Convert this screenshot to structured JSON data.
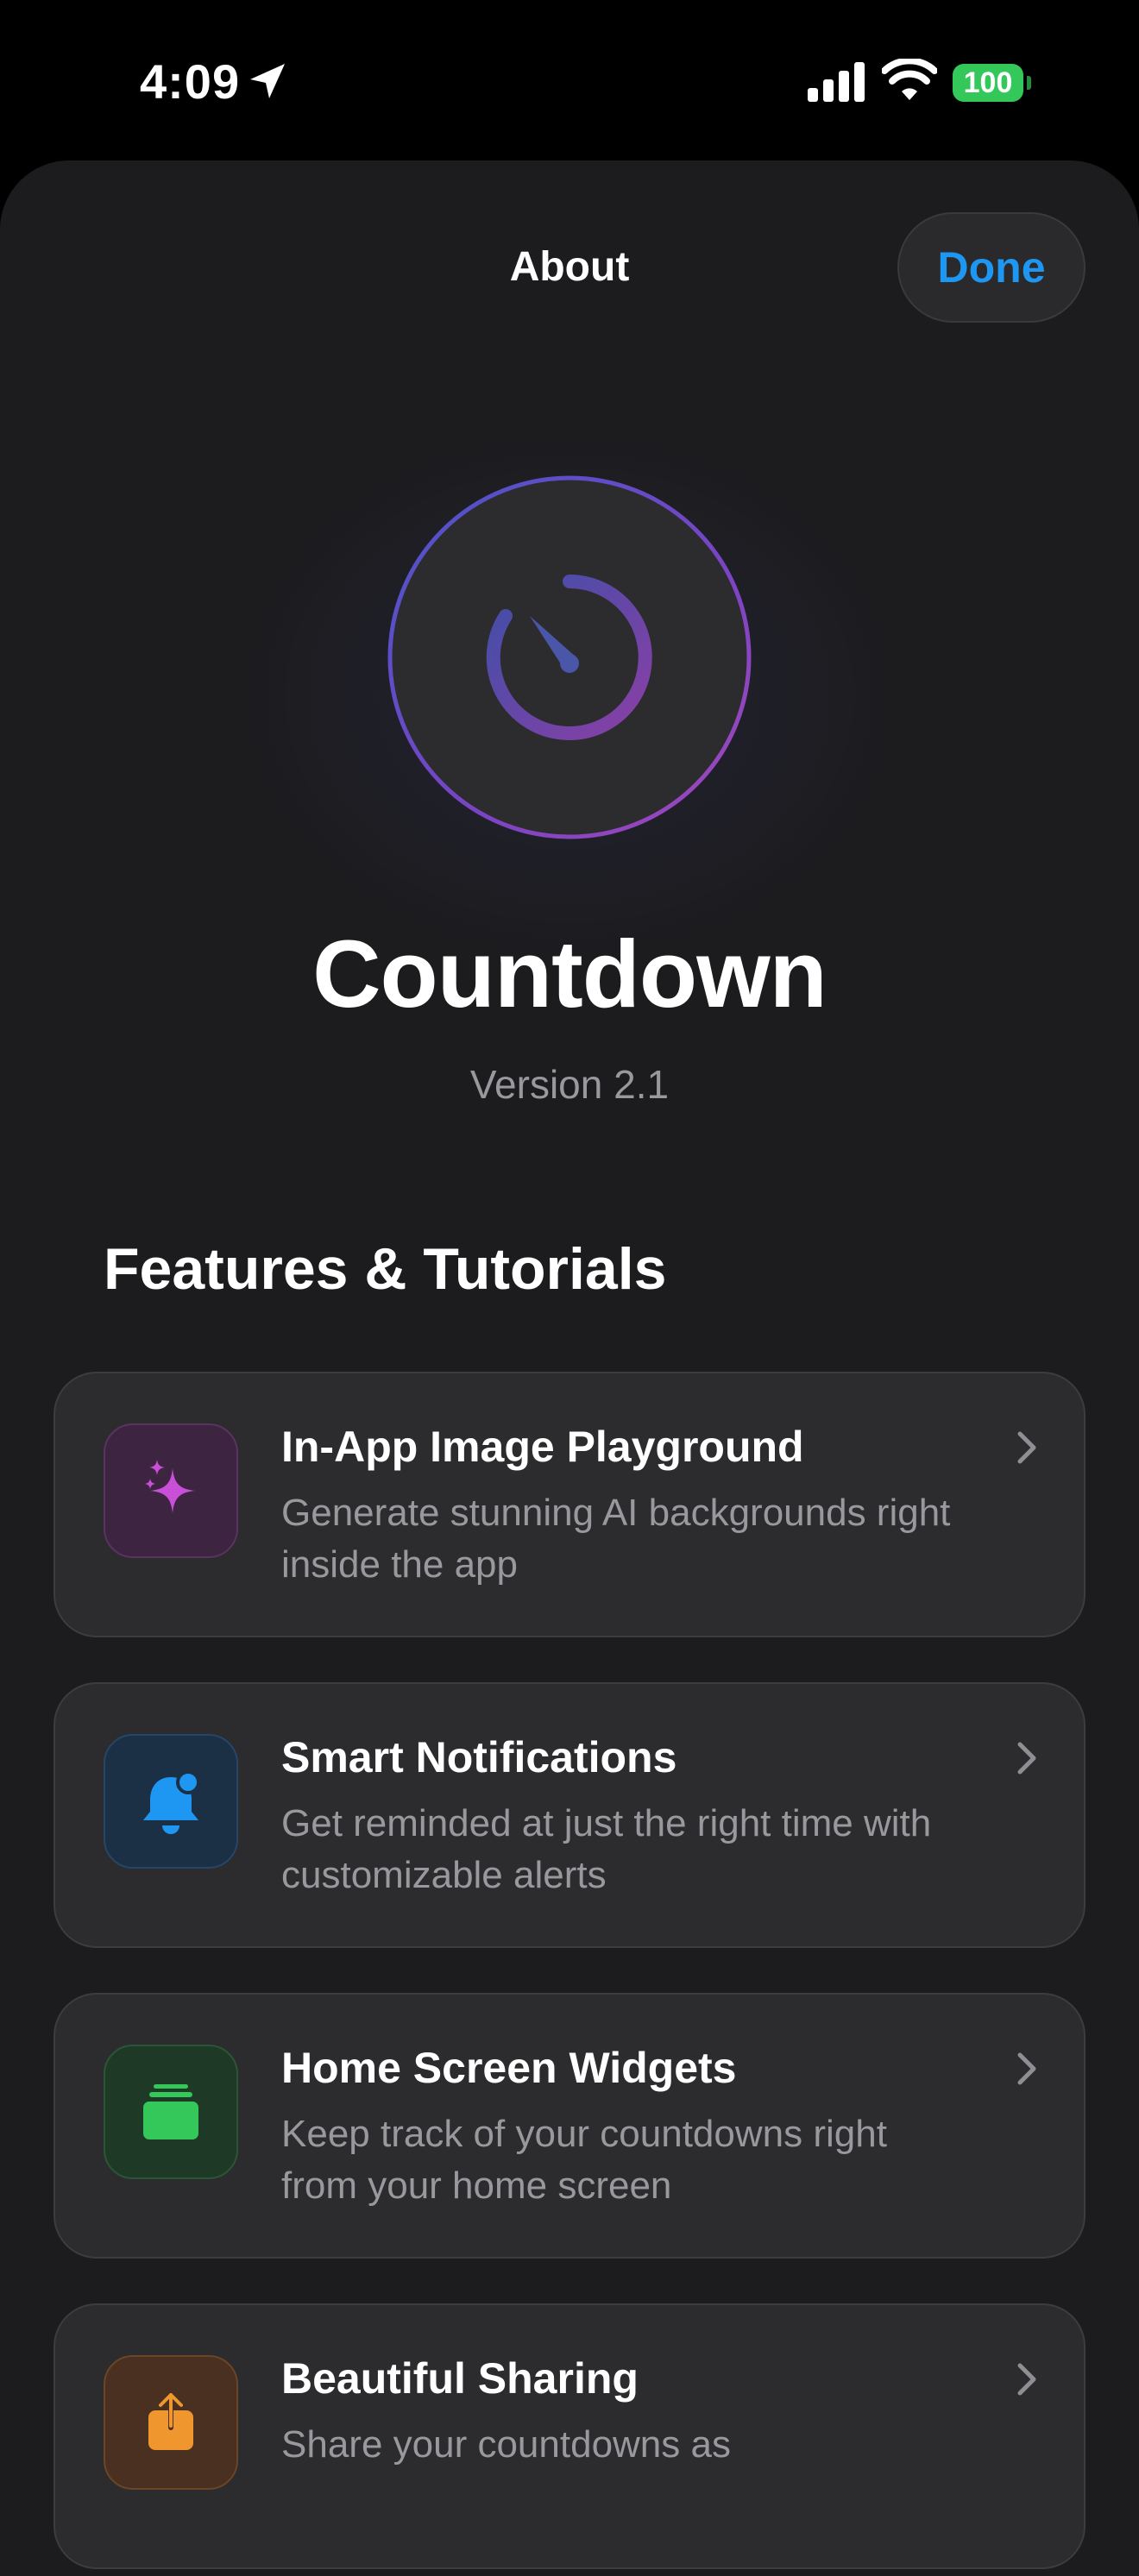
{
  "status_bar": {
    "time": "4:09",
    "battery": "100"
  },
  "sheet": {
    "title": "About",
    "done_label": "Done"
  },
  "app": {
    "name": "Countdown",
    "version": "Version 2.1"
  },
  "features_section": {
    "title": "Features & Tutorials",
    "items": [
      {
        "title": "In-App Image Playground",
        "description": "Generate stunning AI backgrounds right inside the app",
        "icon": "sparkles-icon",
        "color": "#c94fd8"
      },
      {
        "title": "Smart Notifications",
        "description": "Get reminded at just the right time with customizable alerts",
        "icon": "bell-badge-icon",
        "color": "#1e97f2"
      },
      {
        "title": "Home Screen Widgets",
        "description": "Keep track of your countdowns right from your home screen",
        "icon": "widget-stack-icon",
        "color": "#34c759"
      },
      {
        "title": "Beautiful Sharing",
        "description": "Share your countdowns as",
        "icon": "share-icon",
        "color": "#f0962e"
      }
    ]
  },
  "colors": {
    "accent": "#1e97f2",
    "background": "#1c1c1e",
    "card": "#2c2c2e",
    "secondary_text": "#98989d"
  }
}
